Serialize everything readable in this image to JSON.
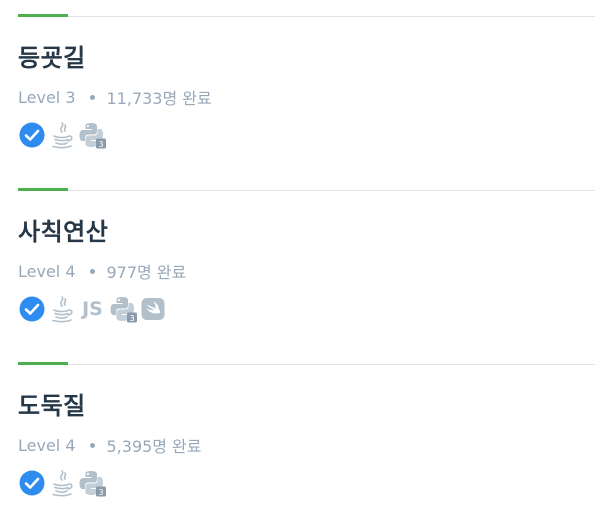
{
  "problems": [
    {
      "title": "등굣길",
      "level": "Level 3",
      "completed_count": "11,733명",
      "completed_label": "완료",
      "languages": [
        "check-icon",
        "java-icon",
        "python3-icon"
      ]
    },
    {
      "title": "사칙연산",
      "level": "Level 4",
      "completed_count": "977명",
      "completed_label": "완료",
      "languages": [
        "check-icon",
        "java-icon",
        "js-icon",
        "python3-icon",
        "swift-icon"
      ],
      "js_label": "JS"
    },
    {
      "title": "도둑질",
      "level": "Level 4",
      "completed_count": "5,395명",
      "completed_label": "완료",
      "languages": [
        "check-icon",
        "java-icon",
        "python3-icon"
      ]
    }
  ],
  "colors": {
    "accent": "#4fae4f",
    "check": "#2e8cf0",
    "muted": "#98a8b9",
    "icon_gray": "#b2c0cc",
    "title": "#263747"
  }
}
